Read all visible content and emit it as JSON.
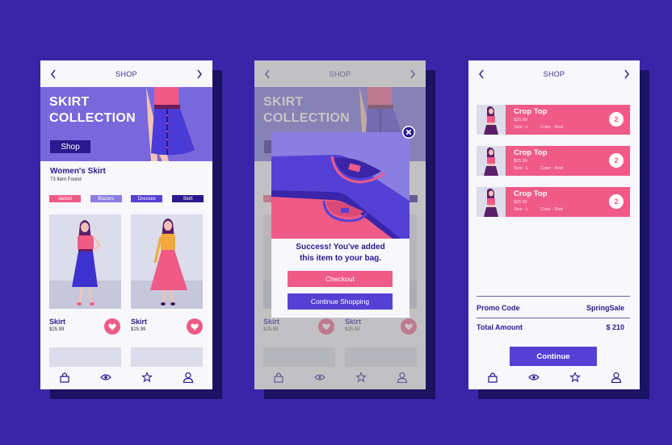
{
  "colors": {
    "background": "#3a25a8",
    "primary": "#5540d6",
    "accent_pink": "#ef5a86",
    "dark_navy": "#2a1a8e",
    "hero_purple": "#7868dc",
    "lavender": "#8a7ee2"
  },
  "screens": [
    {
      "header": {
        "title": "SHOP",
        "back_icon": "chevron-left-icon",
        "forward_icon": "chevron-right-icon"
      },
      "hero": {
        "title_line1": "SKIRT",
        "title_line2": "COLLECTION",
        "button_label": "Shop"
      },
      "section": {
        "title": "Women's Skirt",
        "subtitle": "73 Item Found"
      },
      "chips": [
        {
          "label": "Jacket",
          "color": "#ef5a86"
        },
        {
          "label": "Blazers",
          "color": "#8a7ee2"
        },
        {
          "label": "Dresses",
          "color": "#5540d6"
        },
        {
          "label": "Skirt",
          "color": "#2a1a8e"
        }
      ],
      "products": [
        {
          "name": "Skirt",
          "price": "$25.99",
          "fav_icon": "heart-icon"
        },
        {
          "name": "Skirt",
          "price": "$25.99",
          "fav_icon": "heart-icon"
        }
      ],
      "nav": [
        "bag-icon",
        "eye-icon",
        "star-icon",
        "user-icon"
      ]
    },
    {
      "header": {
        "title": "SHOP"
      },
      "hero": {
        "title_line1": "SKIRT",
        "title_line2": "COLLECTION"
      },
      "products": [
        {
          "name": "Skirt",
          "price": "$25.99"
        },
        {
          "name": "Skirt",
          "price": "$25.99"
        }
      ],
      "popup": {
        "message_line1": "Success! You've added",
        "message_line2": "this item to your bag.",
        "checkout_label": "Checkout",
        "continue_label": "Continue Shopping",
        "close_icon": "close-icon"
      }
    },
    {
      "header": {
        "title": "SHOP"
      },
      "cart": [
        {
          "name": "Crop Top",
          "price": "$25.99",
          "size": "Size : L",
          "color": "Color : Red",
          "quantity": "2"
        },
        {
          "name": "Crop Top",
          "price": "$25.99",
          "size": "Size : L",
          "color": "Color : Red",
          "quantity": "2"
        },
        {
          "name": "Crop Top",
          "price": "$25.99",
          "size": "Size : L",
          "color": "Color : Red",
          "quantity": "2"
        }
      ],
      "promo": {
        "label": "Promo Code",
        "value": "SpringSale"
      },
      "total": {
        "label": "Total Amount",
        "value": "$ 210"
      },
      "continue_label": "Continue"
    }
  ]
}
